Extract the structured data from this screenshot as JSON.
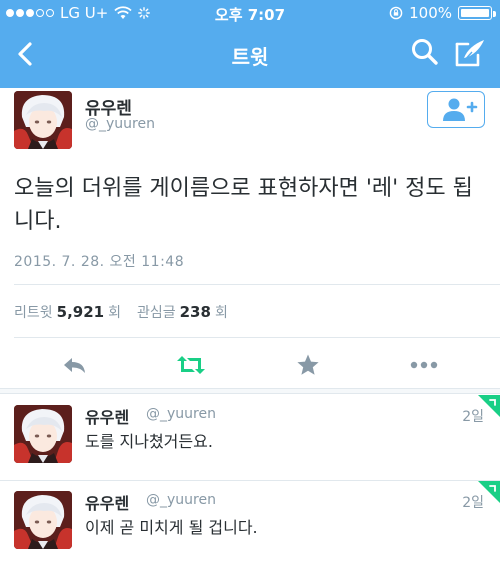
{
  "status_bar": {
    "carrier": "LG U+",
    "time": "오후 7:07",
    "battery": "100%",
    "signal_dots_filled": 3,
    "signal_dots_total": 5
  },
  "nav": {
    "title": "트윗",
    "back_icon": "chevron-left-icon",
    "search_icon": "search-icon",
    "compose_icon": "compose-icon"
  },
  "tweet": {
    "name": "유우렌",
    "handle": "@_yuuren",
    "text": "오늘의 더위를 게이름으로 표현하자면 '레' 정도 됩니다.",
    "date": "2015. 7. 28. 오전 11:48",
    "retweets_label": "리트윗",
    "retweets_count": "5,921",
    "retweets_unit": "회",
    "likes_label": "관심글",
    "likes_count": "238",
    "likes_unit": "회"
  },
  "replies": [
    {
      "name": "유우렌",
      "handle": "@_yuuren",
      "time": "2일",
      "text": "도를 지나쳤거든요."
    },
    {
      "name": "유우렌",
      "handle": "@_yuuren",
      "time": "2일",
      "text": "이제 곧 미치게 될 겁니다."
    }
  ],
  "colors": {
    "brand": "#55acee",
    "retweet": "#19cf86",
    "muted": "#8899a6",
    "text": "#292f33"
  }
}
